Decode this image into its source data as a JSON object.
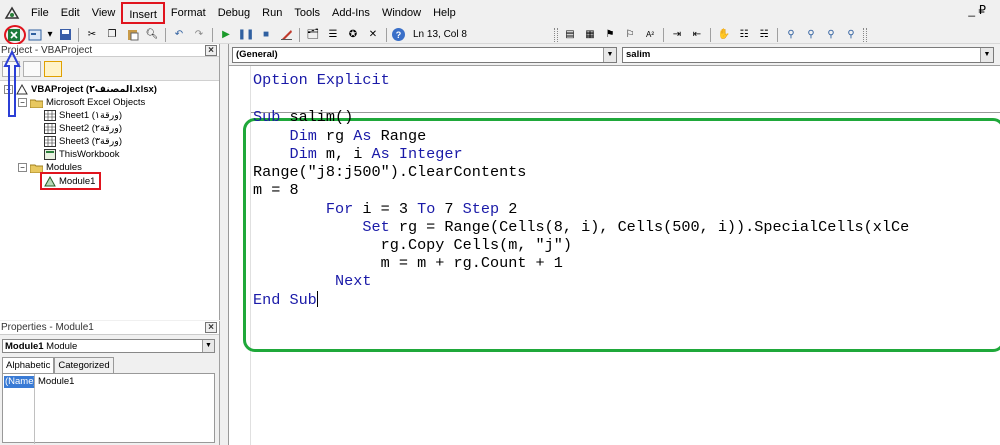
{
  "menu": {
    "items": [
      "File",
      "Edit",
      "View",
      "Insert",
      "Format",
      "Debug",
      "Run",
      "Tools",
      "Add-Ins",
      "Window",
      "Help"
    ],
    "highlighted": "Insert",
    "window_min": "_ ₽"
  },
  "toolbar": {
    "position_status": "Ln 13, Col 8"
  },
  "project": {
    "title": "Project - VBAProject",
    "tree": {
      "root": "VBAProject (المصنف٢.xlsx)",
      "excel_objects_folder": "Microsoft Excel Objects",
      "sheets": [
        "Sheet1 (ورقة١)",
        "Sheet2 (ورقة٢)",
        "Sheet3 (ورقة٣)"
      ],
      "workbook": "ThisWorkbook",
      "modules_folder": "Modules",
      "module": "Module1"
    }
  },
  "properties": {
    "title": "Properties - Module1",
    "object_bold": "Module1",
    "object_type": "Module",
    "tabs": [
      "Alphabetic",
      "Categorized"
    ],
    "row_name": "(Name)",
    "row_value": "Module1"
  },
  "code": {
    "object_dropdown": "(General)",
    "proc_dropdown": "salim",
    "lines": [
      {
        "indent": "",
        "kw": "Option Explicit",
        "rest": ""
      },
      {
        "indent": "",
        "kw": "Sub",
        "rest": " salim()"
      },
      {
        "indent": "    ",
        "kw": "Dim",
        "rest": " rg ",
        "kw2": "As",
        "rest2": " Range"
      },
      {
        "indent": "    ",
        "kw": "Dim",
        "rest": " m, i ",
        "kw2": "As Integer",
        "rest2": ""
      },
      {
        "indent": "",
        "kw": "",
        "rest": "Range(\"j8:j500\").ClearContents"
      },
      {
        "indent": "",
        "kw": "",
        "rest": "m = 8"
      },
      {
        "indent": "        ",
        "kw": "For",
        "rest": " i = 3 ",
        "kw2": "To",
        "rest2": " 7 ",
        "kw3": "Step",
        "rest3": " 2"
      },
      {
        "indent": "            ",
        "kw": "Set",
        "rest": " rg = Range(Cells(8, i), Cells(500, i)).SpecialCells(xlCe"
      },
      {
        "indent": "              ",
        "kw": "",
        "rest": "rg.Copy Cells(m, \"j\")"
      },
      {
        "indent": "              ",
        "kw": "",
        "rest": "m = m + rg.Count + 1"
      },
      {
        "indent": "         ",
        "kw": "Next",
        "rest": ""
      },
      {
        "indent": "",
        "kw": "End Sub",
        "rest": ""
      }
    ]
  },
  "colors": {
    "keyword": "#1a1aa8",
    "annotation_red": "#e0141e",
    "annotation_green": "#1fa83a",
    "annotation_blue": "#2b3fd6"
  }
}
